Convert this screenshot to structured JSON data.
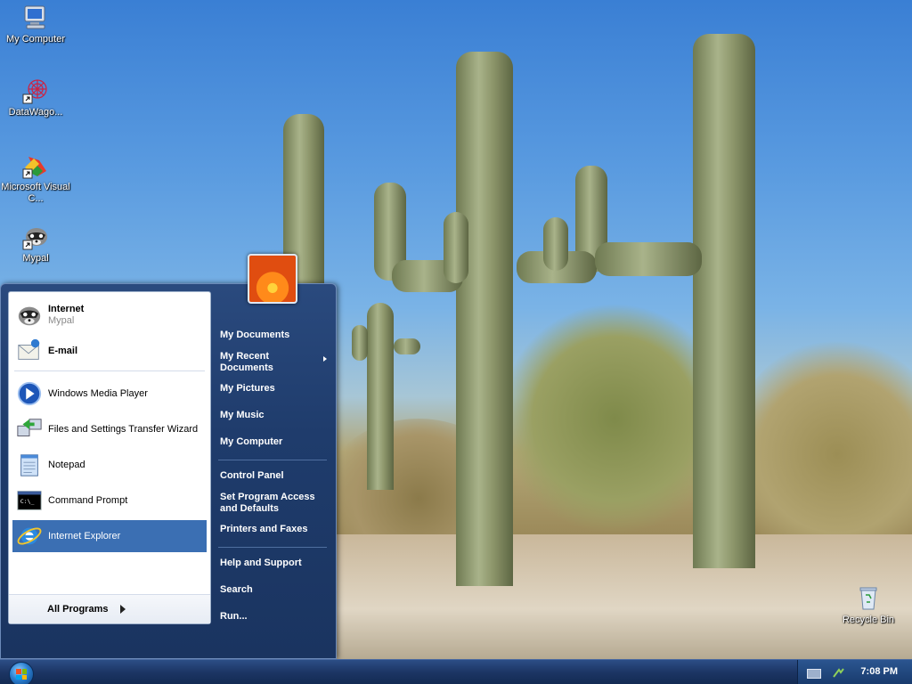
{
  "desktop": {
    "icons": [
      {
        "label": "My Computer",
        "icon": "computer-icon"
      },
      {
        "label": "DataWago...",
        "icon": "datawagon-icon"
      },
      {
        "label": "Microsoft Visual C...",
        "icon": "visual-c-icon"
      },
      {
        "label": "Mypal",
        "icon": "mypal-icon"
      },
      {
        "label": "Recycle Bin",
        "icon": "recycle-bin-icon"
      }
    ]
  },
  "start_menu": {
    "pinned": [
      {
        "title": "Internet",
        "subtitle": "Mypal",
        "icon": "mypal-icon"
      },
      {
        "title": "E-mail",
        "icon": "email-icon"
      }
    ],
    "recent": [
      {
        "label": "Windows Media Player",
        "icon": "media-player-icon"
      },
      {
        "label": "Files and Settings Transfer Wizard",
        "icon": "transfer-wizard-icon"
      },
      {
        "label": "Notepad",
        "icon": "notepad-icon"
      },
      {
        "label": "Command Prompt",
        "icon": "command-prompt-icon"
      },
      {
        "label": "Internet Explorer",
        "icon": "internet-explorer-icon",
        "selected": true
      }
    ],
    "all_programs": "All Programs",
    "right": [
      "My Documents",
      "My Recent Documents",
      "My Pictures",
      "My Music",
      "My Computer",
      "Control Panel",
      "Set Program Access and Defaults",
      "Printers and Faxes",
      "Help and Support",
      "Search",
      "Run..."
    ]
  },
  "taskbar": {
    "clock": "7:08 PM"
  },
  "colors": {
    "selection": "#3b6fb3",
    "menu_bg": "#1f3c6c",
    "taskbar": "#1c3564"
  }
}
